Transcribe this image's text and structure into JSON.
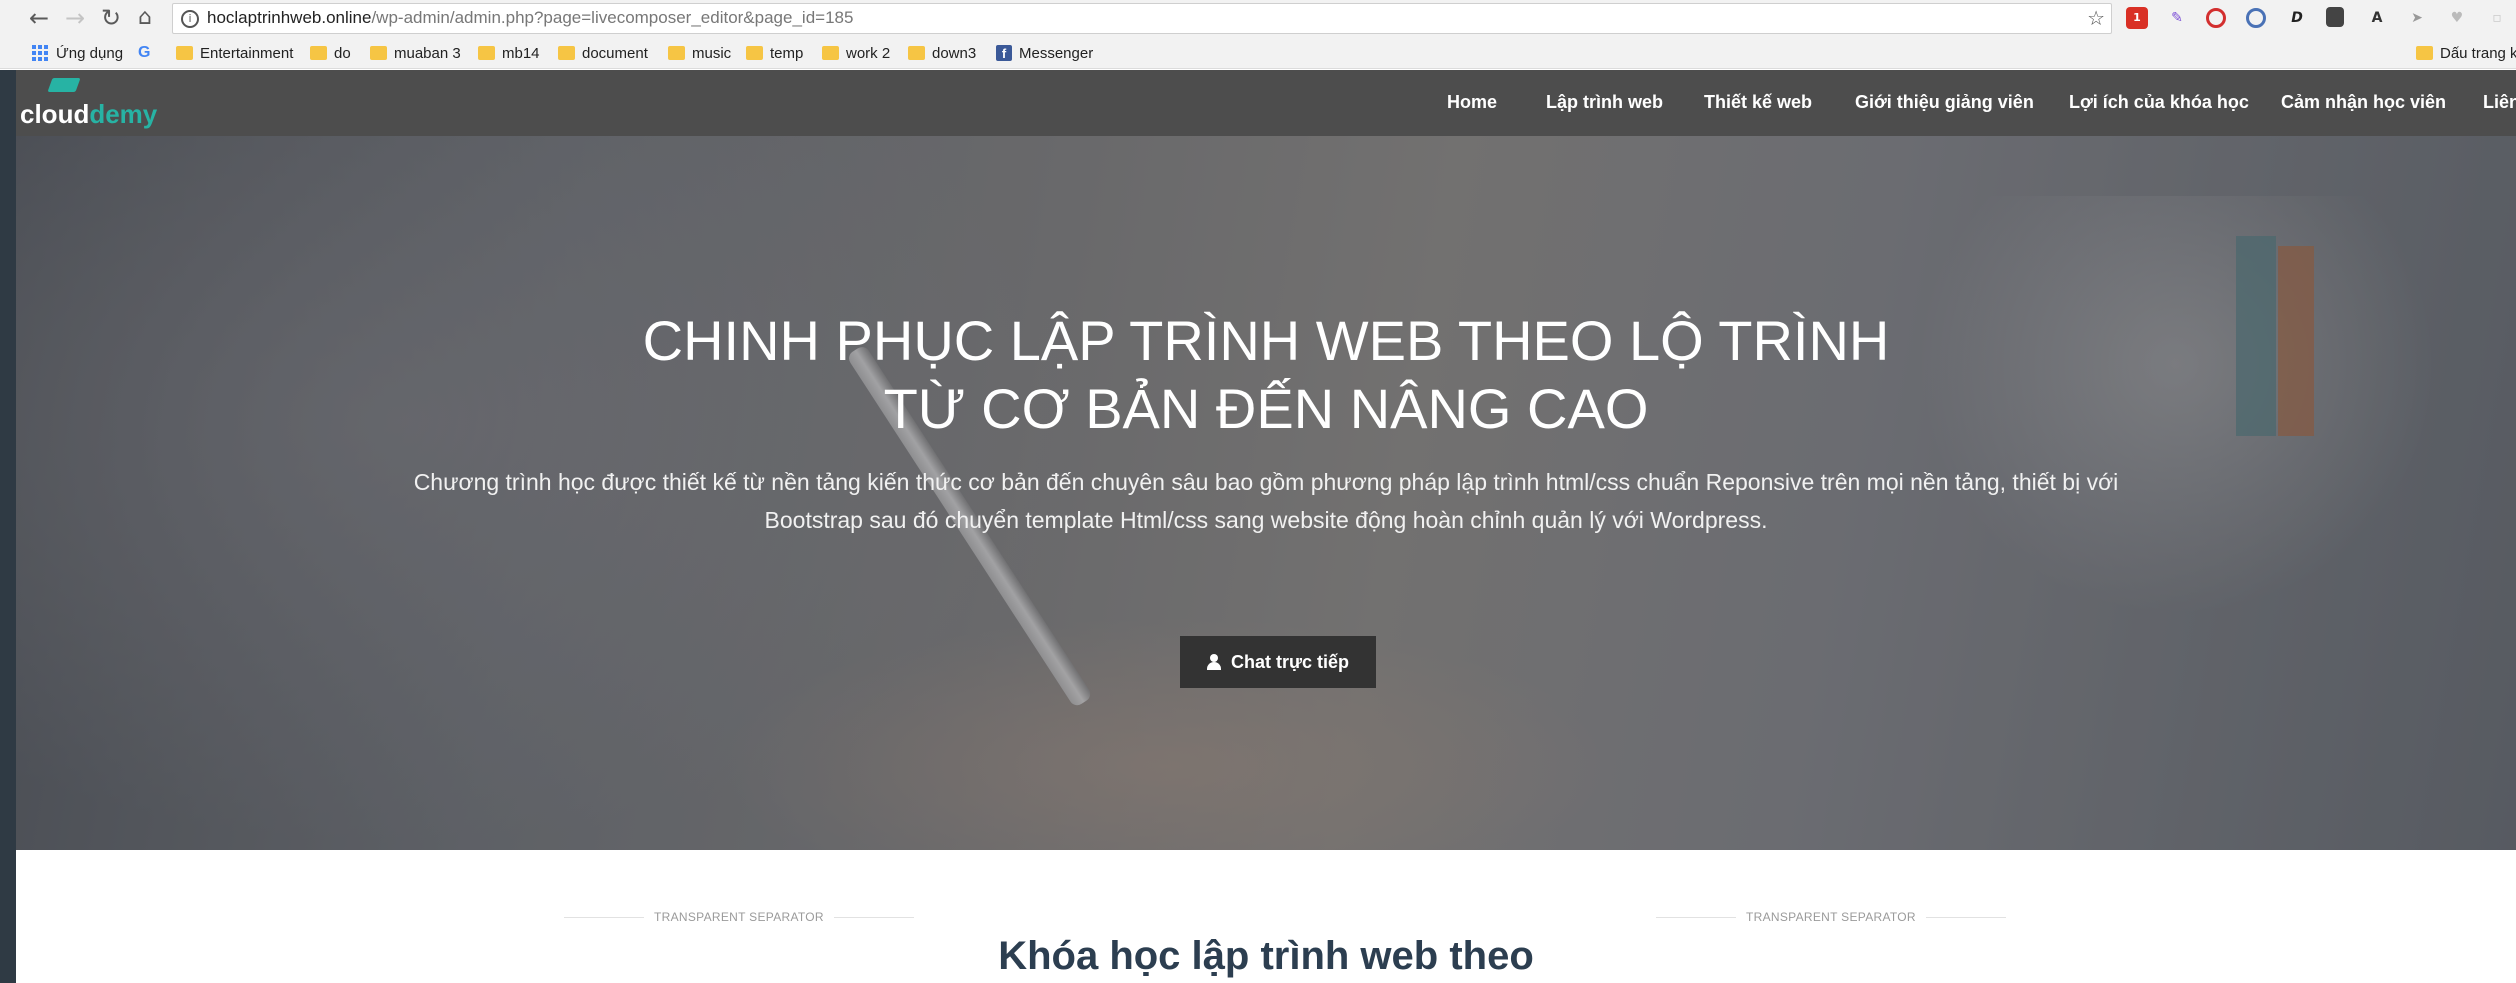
{
  "browser": {
    "url_host": "hoclaptrinhweb.online",
    "url_path": "/wp-admin/admin.php?page=livecomposer_editor&page_id=185",
    "bookmarks": [
      "Ứng dụng",
      "Entertainment",
      "do",
      "muaban 3",
      "mb14",
      "document",
      "music",
      "temp",
      "work 2",
      "down3",
      "Messenger"
    ],
    "other_bookmarks": "Dấu trang k",
    "extension_badge": "1"
  },
  "site": {
    "logo_cloud": "cloud",
    "logo_demy": "demy",
    "menu": [
      "Home",
      "Lập trình web",
      "Thiết kế web",
      "Giới thiệu giảng viên",
      "Lợi ích của khóa học",
      "Cảm nhận học viên",
      "Liên"
    ]
  },
  "hero": {
    "title_line1": "CHINH PHỤC LẬP TRÌNH WEB THEO LỘ TRÌNH",
    "title_line2": "TỪ CƠ BẢN ĐẾN NÂNG CAO",
    "subtitle_line1": "Chương trình học được thiết kế từ nền tảng kiến thức cơ bản đến chuyên sâu bao gồm phương pháp lập trình html/css chuẩn Reponsive trên mọi nền tảng, thiết bị với",
    "subtitle_line2": "Bootstrap sau đó chuyển template Html/css sang website động hoàn chỉnh quản lý với Wordpress.",
    "cta": "Chat trực tiếp"
  },
  "section": {
    "separator_left": "TRANSPARENT SEPARATOR",
    "separator_right": "TRANSPARENT SEPARATOR",
    "title": "Khóa học lập trình web theo"
  },
  "colors": {
    "header_bg": "#4d4d4d",
    "brand_teal": "#27b3a4",
    "section_title": "#2c3e50",
    "cta_bg": "#333333"
  }
}
